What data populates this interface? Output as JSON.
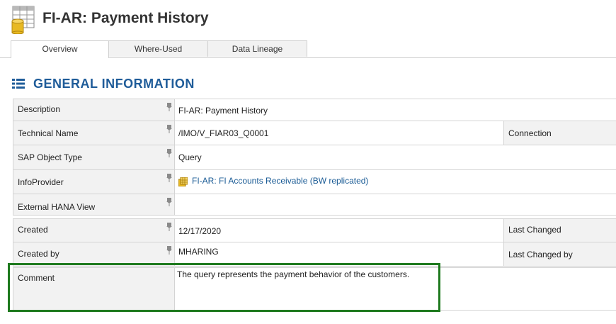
{
  "header": {
    "title": "FI-AR: Payment History"
  },
  "tabs": [
    {
      "label": "Overview"
    },
    {
      "label": "Where-Used"
    },
    {
      "label": "Data Lineage"
    }
  ],
  "section": {
    "title": "GENERAL INFORMATION"
  },
  "fields": {
    "description": {
      "label": "Description",
      "value": "FI-AR: Payment History"
    },
    "technical_name": {
      "label": "Technical Name",
      "value": "/IMO/V_FIAR03_Q0001"
    },
    "connection": {
      "label": "Connection"
    },
    "sap_object_type": {
      "label": "SAP Object Type",
      "value": "Query"
    },
    "infoprovider": {
      "label": "InfoProvider",
      "value": "FI-AR: FI Accounts Receivable (BW replicated)"
    },
    "external_hana_view": {
      "label": "External HANA View",
      "value": ""
    },
    "created": {
      "label": "Created",
      "value": "12/17/2020"
    },
    "last_changed": {
      "label": "Last Changed"
    },
    "created_by": {
      "label": "Created by",
      "value": "MHARING"
    },
    "last_changed_by": {
      "label": "Last Changed by"
    },
    "comment": {
      "label": "Comment",
      "value": "The query represents the payment behavior of the customers."
    }
  },
  "colors": {
    "accent": "#1f5c99",
    "link": "#1a5b95",
    "highlight": "#1f7a1f"
  },
  "icons": {
    "title": "database-table-icon",
    "section": "list-icon",
    "pin": "pin-icon",
    "infoprovider": "cube-icon"
  }
}
